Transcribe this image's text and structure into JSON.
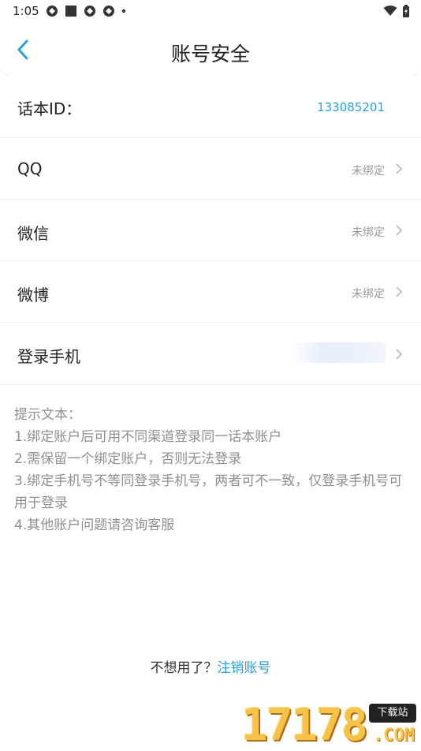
{
  "status_bar": {
    "time": "1:05",
    "icons": [
      "notification-icon",
      "square-icon",
      "notification-icon",
      "notification-icon",
      "dot-icon"
    ],
    "right_icons": [
      "wifi-icon",
      "battery-icon"
    ]
  },
  "header": {
    "title": "账号安全",
    "back_icon": "chevron-left-icon"
  },
  "account": {
    "id_label": "话本ID：",
    "id_value": "133085201"
  },
  "bindings": [
    {
      "label": "QQ",
      "status": "未绑定"
    },
    {
      "label": "微信",
      "status": "未绑定"
    },
    {
      "label": "微博",
      "status": "未绑定"
    }
  ],
  "phone": {
    "label": "登录手机"
  },
  "tips": {
    "title": "提示文本：",
    "lines": [
      "1.绑定账户后可用不同渠道登录同一话本账户",
      "2.需保留一个绑定账户，否则无法登录",
      "3.绑定手机号不等同登录手机号，两者可不一致，仅登录手机号可用于登录",
      "4.其他账户问题请咨询客服"
    ]
  },
  "footer": {
    "prompt": "不想用了？",
    "cancel_link": "注销账号"
  },
  "watermark": {
    "digits": "17178",
    "badge": "下载站",
    "domain": ".COM"
  },
  "colors": {
    "accent": "#2a9ed8",
    "muted": "#999999",
    "divider": "#eeeeee"
  }
}
